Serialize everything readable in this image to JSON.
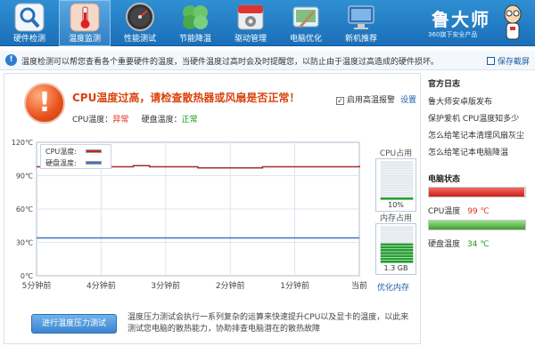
{
  "nav": {
    "items": [
      {
        "label": "硬件检测",
        "icon": "magnifier-icon"
      },
      {
        "label": "温度监测",
        "icon": "thermometer-icon"
      },
      {
        "label": "性能测试",
        "icon": "speedometer-icon"
      },
      {
        "label": "节能降温",
        "icon": "leaf-icon"
      },
      {
        "label": "驱动管理",
        "icon": "driver-gear-icon"
      },
      {
        "label": "电脑优化",
        "icon": "broom-icon"
      },
      {
        "label": "新机推荐",
        "icon": "monitor-icon"
      }
    ],
    "active_index": 1,
    "brand": "鲁大师",
    "brand_sub": "360旗下安全产品"
  },
  "infobar": {
    "text": "温度检测可以帮您查看各个重要硬件的温度，当硬件温度过高时会及时提醒您，以防止由于温度过高造成的硬件损坏。",
    "save_label": "保存截屏"
  },
  "alert": {
    "title": "CPU温度过高，请检查散热器或风扇是否正常！",
    "cpu_label": "CPU温度：",
    "cpu_status": "异常",
    "disk_label": "硬盘温度：",
    "disk_status": "正常",
    "alarm_label": "启用高温报警",
    "alarm_checked": true,
    "settings_label": "设置"
  },
  "chart_data": {
    "type": "line",
    "y_ticks": [
      "120℃",
      "90℃",
      "60℃",
      "30℃",
      "0℃"
    ],
    "ylim": [
      0,
      120
    ],
    "x_ticks": [
      "5分钟前",
      "4分钟前",
      "3分钟前",
      "2分钟前",
      "1分钟前",
      "当前"
    ],
    "series": [
      {
        "name": "CPU温度:",
        "color": "#a8282a",
        "values": [
          98,
          98,
          98,
          98,
          98,
          98,
          99,
          98,
          98,
          98,
          97,
          97,
          97,
          97,
          98,
          98,
          98,
          98,
          98,
          98,
          99
        ]
      },
      {
        "name": "硬盘温度:",
        "color": "#3f74c2",
        "values": [
          34,
          34,
          34,
          34,
          34,
          34,
          34,
          34,
          34,
          34,
          34,
          34,
          34,
          34,
          34,
          34,
          34,
          34,
          34,
          34,
          34
        ]
      }
    ]
  },
  "cpu_usage": {
    "title": "CPU占用",
    "value_text": "10%",
    "fraction": 0.1
  },
  "mem_usage": {
    "title": "内存占用",
    "value_text": "1.3 GB",
    "fraction": 0.55
  },
  "optimize_label": "优化内存",
  "stress": {
    "button": "进行温度压力测试",
    "desc": "温度压力测试会执行一系列复杂的运算来快速提升CPU以及显卡的温度，以此来测试您电脑的散热能力，协助排查电脑潜在的散热故障"
  },
  "sidebar": {
    "news_title": "官方日志",
    "news": [
      "鲁大师安卓版发布",
      "保护爱机 CPU温度知多少",
      "怎么给笔记本清理风扇灰尘",
      "怎么给笔记本电脑降温"
    ],
    "status_title": "电脑状态",
    "cpu_label": "CPU温度",
    "cpu_value": "99 ℃",
    "cpu_fraction": 0.99,
    "disk_label": "硬盘温度",
    "disk_value": "34 ℃",
    "disk_fraction": 1.0
  }
}
